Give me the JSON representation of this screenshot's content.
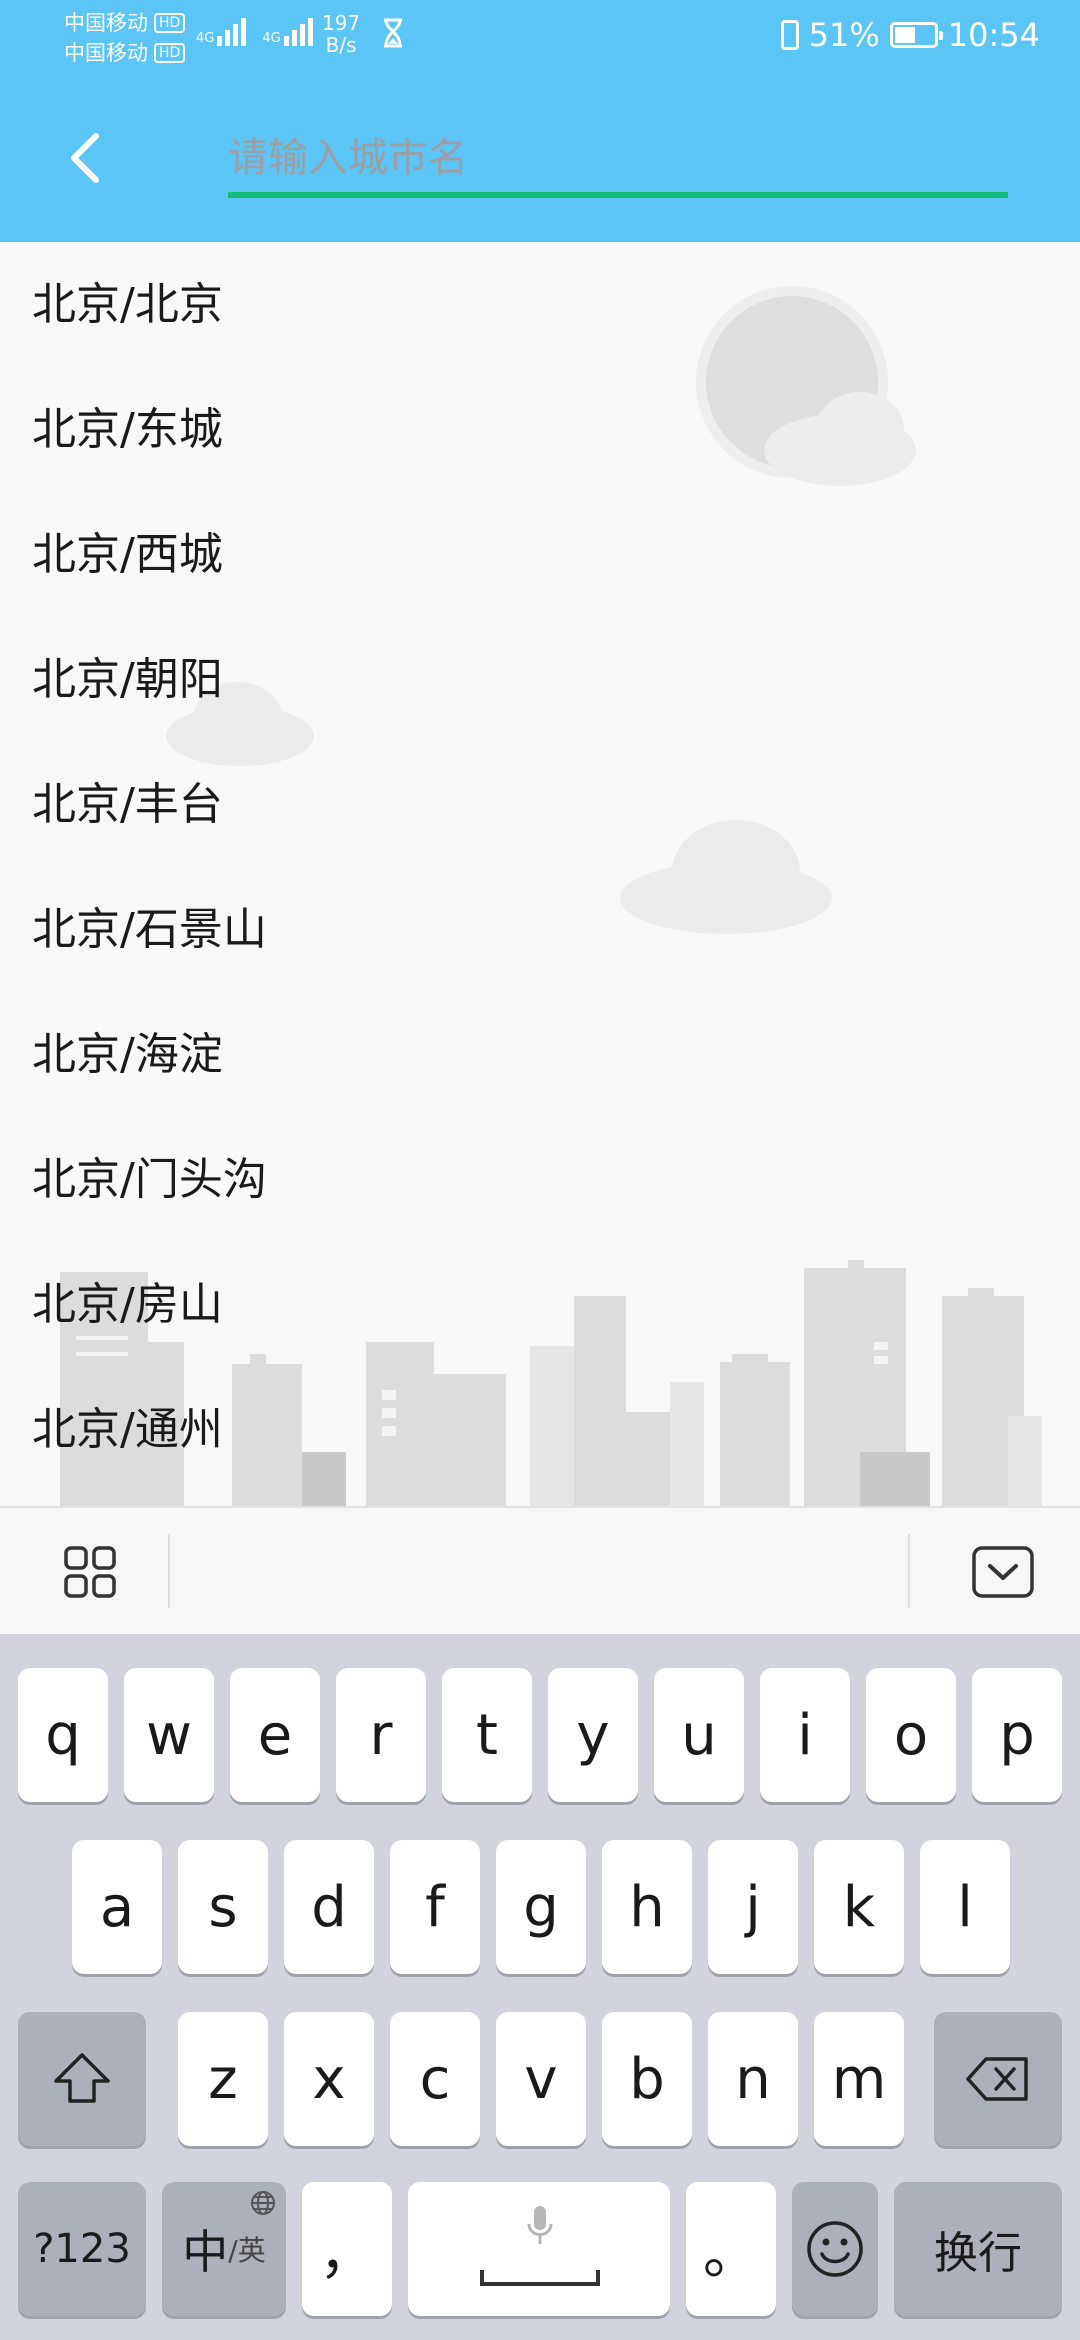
{
  "status_bar": {
    "carrier1": "中国移动",
    "carrier2": "中国移动",
    "hd_badge": "HD",
    "network1": "4G",
    "network2": "4G",
    "speed_value": "197",
    "speed_unit": "B/s",
    "battery_percent": "51%",
    "time": "10:54"
  },
  "search": {
    "placeholder": "请输入城市名",
    "value": ""
  },
  "city_list": [
    "北京/北京",
    "北京/东城",
    "北京/西城",
    "北京/朝阳",
    "北京/丰台",
    "北京/石景山",
    "北京/海淀",
    "北京/门头沟",
    "北京/房山",
    "北京/通州"
  ],
  "keyboard": {
    "row1": [
      "q",
      "w",
      "e",
      "r",
      "t",
      "y",
      "u",
      "i",
      "o",
      "p"
    ],
    "row2": [
      "a",
      "s",
      "d",
      "f",
      "g",
      "h",
      "j",
      "k",
      "l"
    ],
    "row3": [
      "z",
      "x",
      "c",
      "v",
      "b",
      "n",
      "m"
    ],
    "numeric_label": "?123",
    "lang_main": "中",
    "lang_sub": "/英",
    "comma": "，",
    "period": "。",
    "enter_label": "换行"
  },
  "colors": {
    "header_bg": "#5bc5f5",
    "accent_underline": "#16b97a",
    "keyboard_bg": "#d1d4dc"
  }
}
